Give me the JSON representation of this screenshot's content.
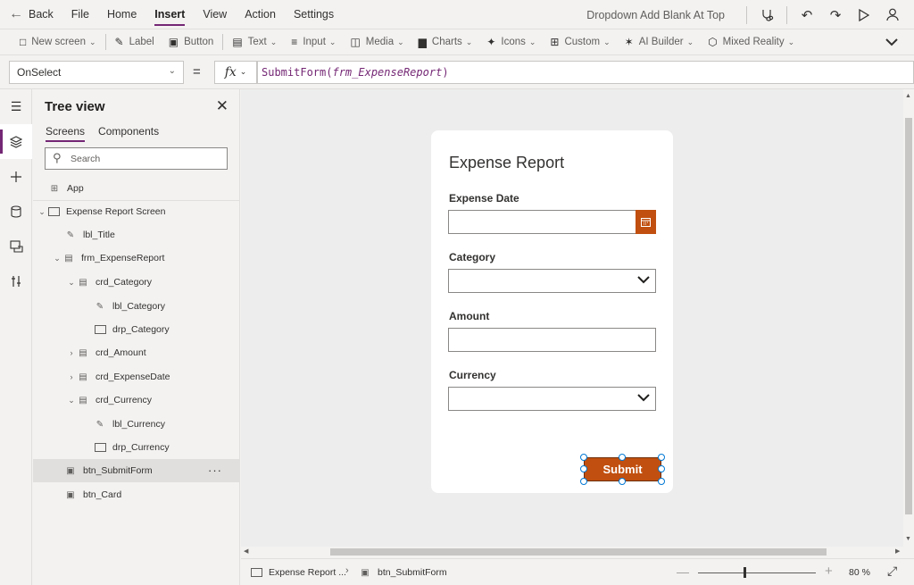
{
  "menubar": {
    "back_label": "Back",
    "items": [
      "File",
      "Home",
      "Insert",
      "View",
      "Action",
      "Settings"
    ],
    "active": "Insert",
    "app_title": "Dropdown Add Blank At Top"
  },
  "ribbon": {
    "new_screen": "New screen",
    "label": "Label",
    "button": "Button",
    "text": "Text",
    "input": "Input",
    "media": "Media",
    "charts": "Charts",
    "icons": "Icons",
    "custom": "Custom",
    "ai_builder": "AI Builder",
    "mixed_reality": "Mixed Reality"
  },
  "formula": {
    "property": "OnSelect",
    "equals": "=",
    "fx": "fx",
    "func": "SubmitForm(",
    "arg": "frm_ExpenseReport",
    "close": ")"
  },
  "tree": {
    "title": "Tree view",
    "tabs": [
      "Screens",
      "Components"
    ],
    "search_placeholder": "Search",
    "app": "App",
    "nodes": {
      "screen": "Expense Report Screen",
      "lbl_title": "lbl_Title",
      "form": "frm_ExpenseReport",
      "crd_category": "crd_Category",
      "lbl_category": "lbl_Category",
      "drp_category": "drp_Category",
      "crd_amount": "crd_Amount",
      "crd_expensedate": "crd_ExpenseDate",
      "crd_currency": "crd_Currency",
      "lbl_currency": "lbl_Currency",
      "drp_currency": "drp_Currency",
      "btn_submit": "btn_SubmitForm",
      "btn_card": "btn_Card"
    },
    "more": "···"
  },
  "form": {
    "title": "Expense Report",
    "fields": {
      "date": "Expense Date",
      "category": "Category",
      "amount": "Amount",
      "currency": "Currency"
    },
    "submit": "Submit"
  },
  "statusbar": {
    "screen_crumb": "Expense Report ...",
    "control_crumb": "btn_SubmitForm",
    "zoom_value": "80",
    "zoom_unit": "%"
  },
  "colors": {
    "accent": "#742774",
    "button": "#c14f0f",
    "selection": "#0078d4"
  }
}
